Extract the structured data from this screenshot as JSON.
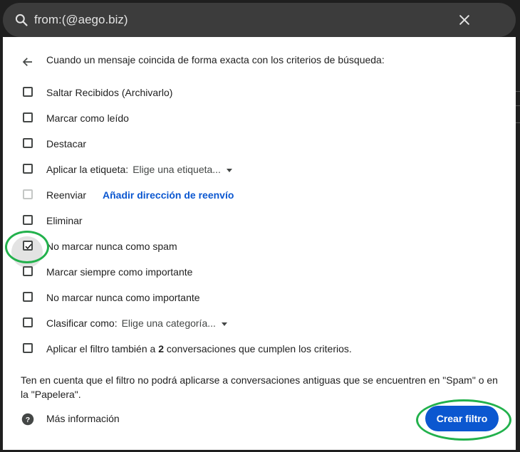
{
  "search": {
    "query": "from:(@aego.biz)",
    "search_icon": "search-icon",
    "close_icon": "close-icon"
  },
  "filter_panel": {
    "back_icon": "arrow-left-icon",
    "header": "Cuando un mensaje coincida de forma exacta con los criterios de búsqueda:",
    "options": [
      {
        "label": "Saltar Recibidos (Archivarlo)",
        "checked": false
      },
      {
        "label": "Marcar como leído",
        "checked": false
      },
      {
        "label": "Destacar",
        "checked": false
      },
      {
        "label": "Aplicar la etiqueta:",
        "dropdown": "Elige una etiqueta...",
        "checked": false
      },
      {
        "label": "Reenviar",
        "link": "Añadir dirección de reenvío",
        "checked": false,
        "disabled": true
      },
      {
        "label": "Eliminar",
        "checked": false
      },
      {
        "label": "No marcar nunca como spam",
        "checked": true
      },
      {
        "label": "Marcar siempre como importante",
        "checked": false
      },
      {
        "label": "No marcar nunca como importante",
        "checked": false
      },
      {
        "label": "Clasificar como:",
        "dropdown": "Elige una categoría...",
        "checked": false
      },
      {
        "label_pre": "Aplicar el filtro también a ",
        "label_bold": "2",
        "label_post": " conversaciones que cumplen los criterios.",
        "checked": false
      }
    ],
    "note": "Ten en cuenta que el filtro no podrá aplicarse a conversaciones antiguas que se encuentren en \"Spam\" o en la \"Papelera\".",
    "help_icon": "help-circle-icon",
    "help_label": "Más información",
    "create_button": "Crear filtro"
  },
  "colors": {
    "primary": "#0b57d0",
    "annotation": "#22b14c",
    "searchbar": "#3c3c3c"
  }
}
